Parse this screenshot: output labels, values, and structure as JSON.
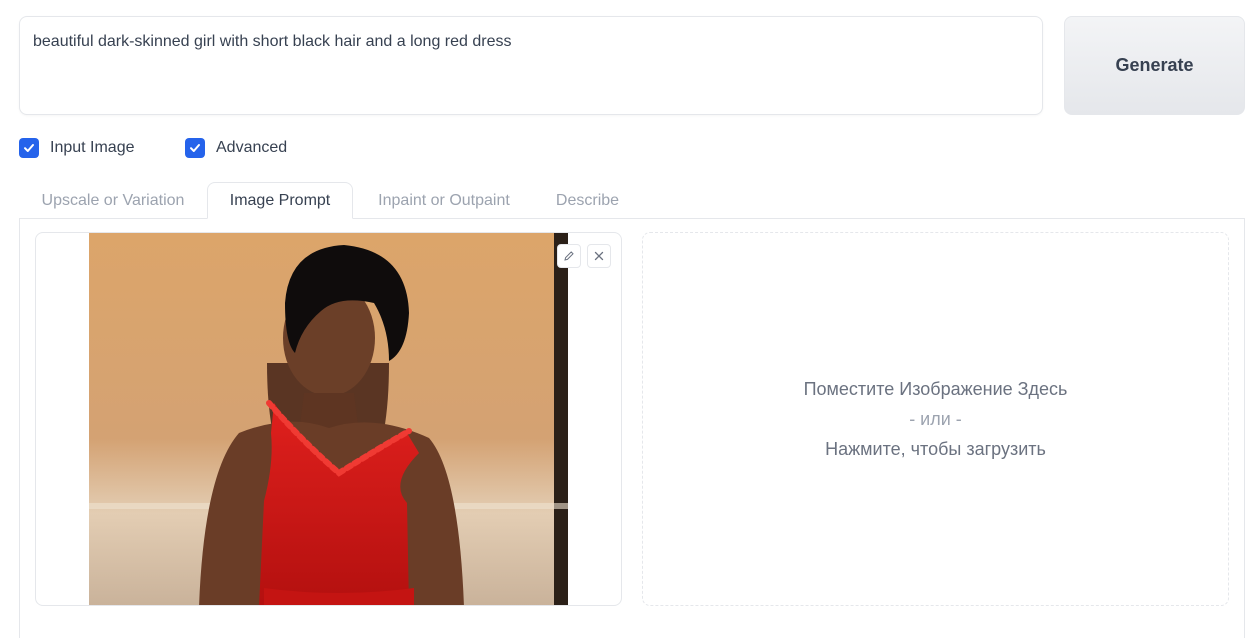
{
  "prompt": {
    "value": "beautiful dark-skinned girl with short black hair and a long red dress"
  },
  "generate_label": "Generate",
  "options": [
    {
      "label": "Input Image",
      "checked": true
    },
    {
      "label": "Advanced",
      "checked": true
    }
  ],
  "tabs": [
    {
      "label": "Upscale or Variation",
      "active": false
    },
    {
      "label": "Image Prompt",
      "active": true
    },
    {
      "label": "Inpaint or Outpaint",
      "active": false
    },
    {
      "label": "Describe",
      "active": false
    }
  ],
  "image_box": {
    "edit_icon": "pencil-icon",
    "clear_icon": "close-icon"
  },
  "drop_zone": {
    "line1": "Поместите Изображение Здесь",
    "line2": "- или -",
    "line3": "Нажмите, чтобы загрузить"
  },
  "colors": {
    "accent": "#2563eb",
    "border": "#e5e7eb",
    "dress": "#d11a1a",
    "background_wall": "#d9a46a"
  }
}
